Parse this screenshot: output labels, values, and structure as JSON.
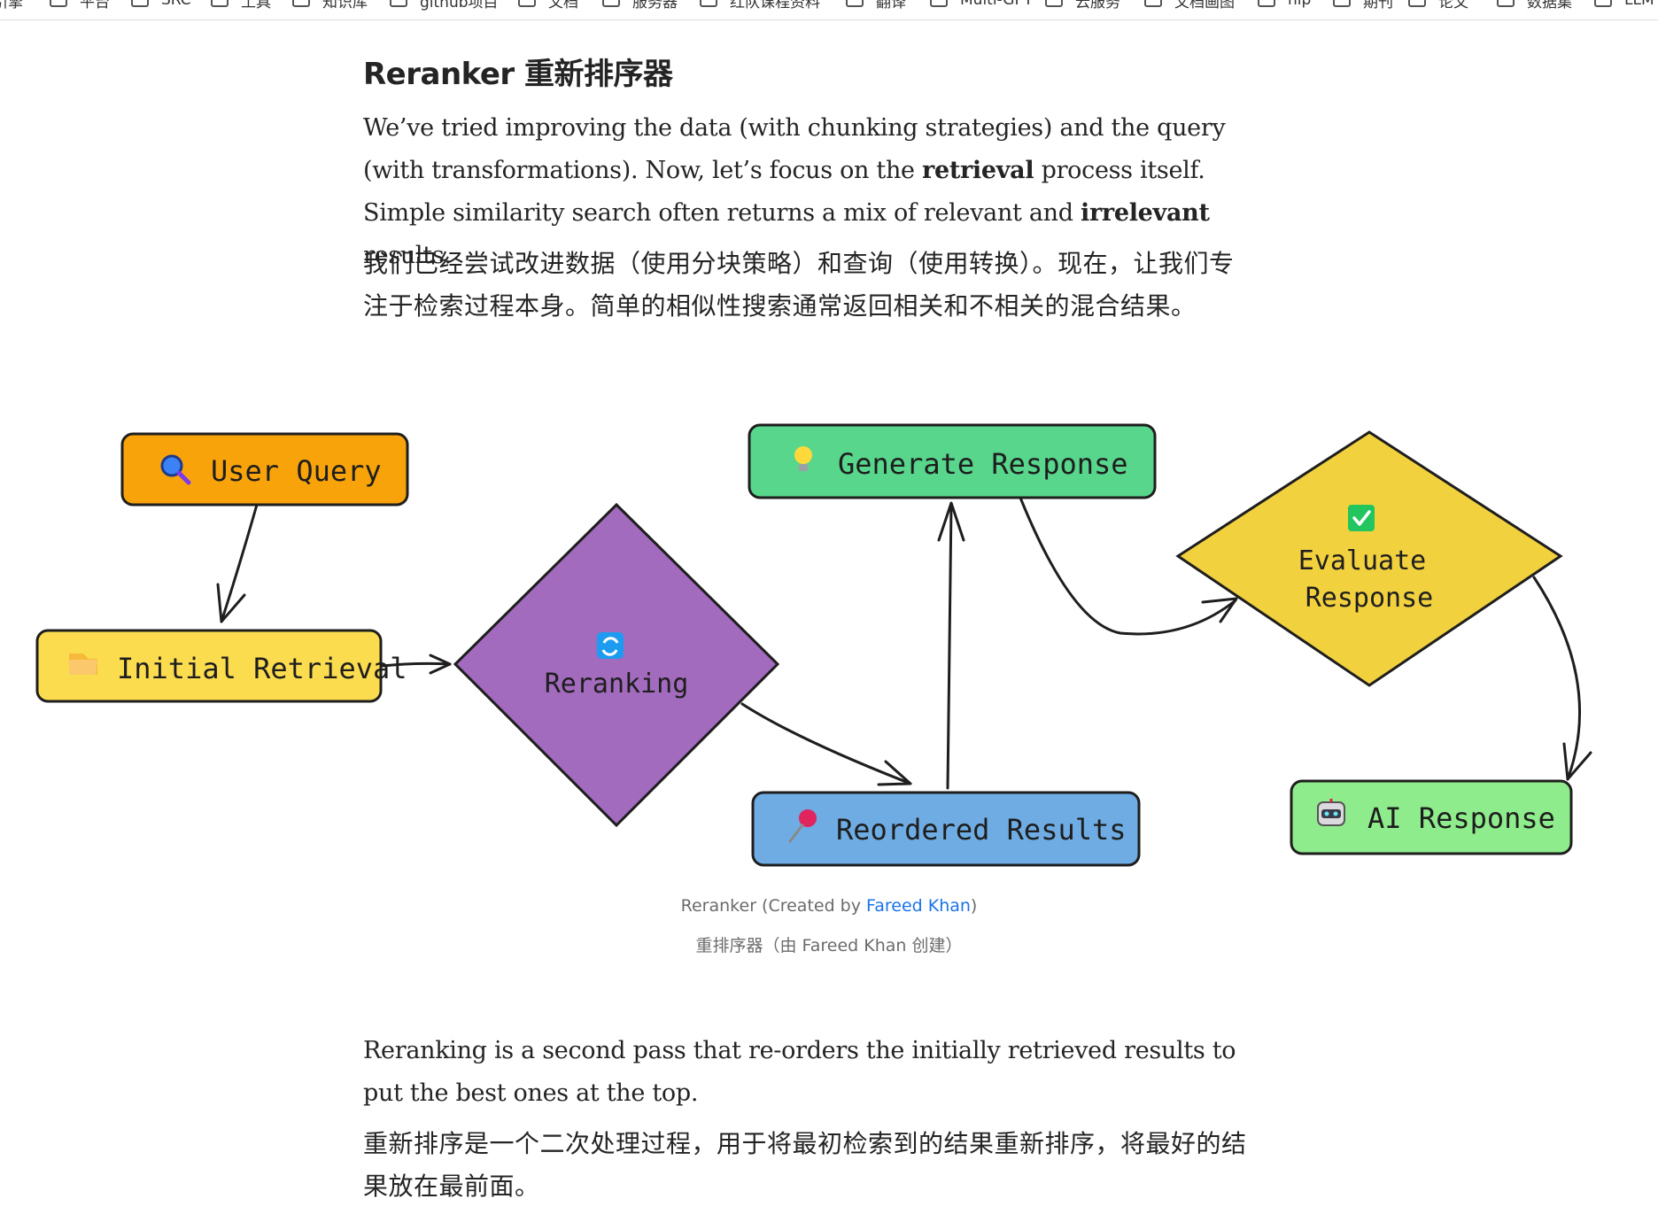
{
  "bookmarks": [
    "引擎",
    "平台",
    "SRC",
    "工具",
    "知识库",
    "github项目",
    "文档",
    "服务器",
    "红队课程资料",
    "翻译",
    "Multi-GPT",
    "云服务",
    "文档画图",
    "hip",
    "期刊",
    "论文",
    "数据集",
    "LLM"
  ],
  "article": {
    "heading": "Reranker 重新排序器",
    "intro_en": {
      "t1": "We’ve tried improving the data (with chunking strategies) and the query (with transformations). Now, let’s focus on the ",
      "b1": "retrieval",
      "t2": " process itself. Simple similarity search often returns a mix of relevant and ",
      "b2": "irrelevant",
      "t3": " results."
    },
    "intro_zh": "我们已经尝试改进数据（使用分块策略）和查询（使用转换）。现在，让我们专注于检索过程本身。简单的相似性搜索通常返回相关和不相关的混合结果。",
    "after_en": "Reranking is a second pass that re-orders the initially retrieved results to put the best ones at the top.",
    "after_zh": "重新排序是一个二次处理过程，用于将最初检索到的结果重新排序，将最好的结果放在最前面。"
  },
  "diagram": {
    "nodes": {
      "user_query": {
        "label": "User Query",
        "icon": "magnifier-icon",
        "color": "#f9a30b"
      },
      "initial_retrieval": {
        "label": "Initial Retrieval",
        "icon": "folder-icon",
        "color": "#fcdc4f"
      },
      "reranking": {
        "label": "Reranking",
        "icon": "refresh-icon",
        "color": "#a26bbd"
      },
      "reordered_results": {
        "label": "Reordered Results",
        "icon": "pushpin-icon",
        "color": "#6eace3"
      },
      "generate_response": {
        "label": "Generate Response",
        "icon": "lightbulb-icon",
        "color": "#57d68c"
      },
      "evaluate_response": {
        "label_line1": "Evaluate",
        "label_line2": "Response",
        "icon": "checkmark-icon",
        "color": "#f2d13f"
      },
      "ai_response": {
        "label": "AI Response",
        "icon": "robot-icon",
        "color": "#8fec8c"
      }
    }
  },
  "caption": {
    "en_prefix": "Reranker (Created by ",
    "en_link": "Fareed Khan",
    "en_suffix": ")",
    "zh": "重排序器（由 Fareed Khan 创建）"
  },
  "colors": {
    "link": "#1a73e8",
    "text": "#242424",
    "caption": "#6b6b6b"
  }
}
